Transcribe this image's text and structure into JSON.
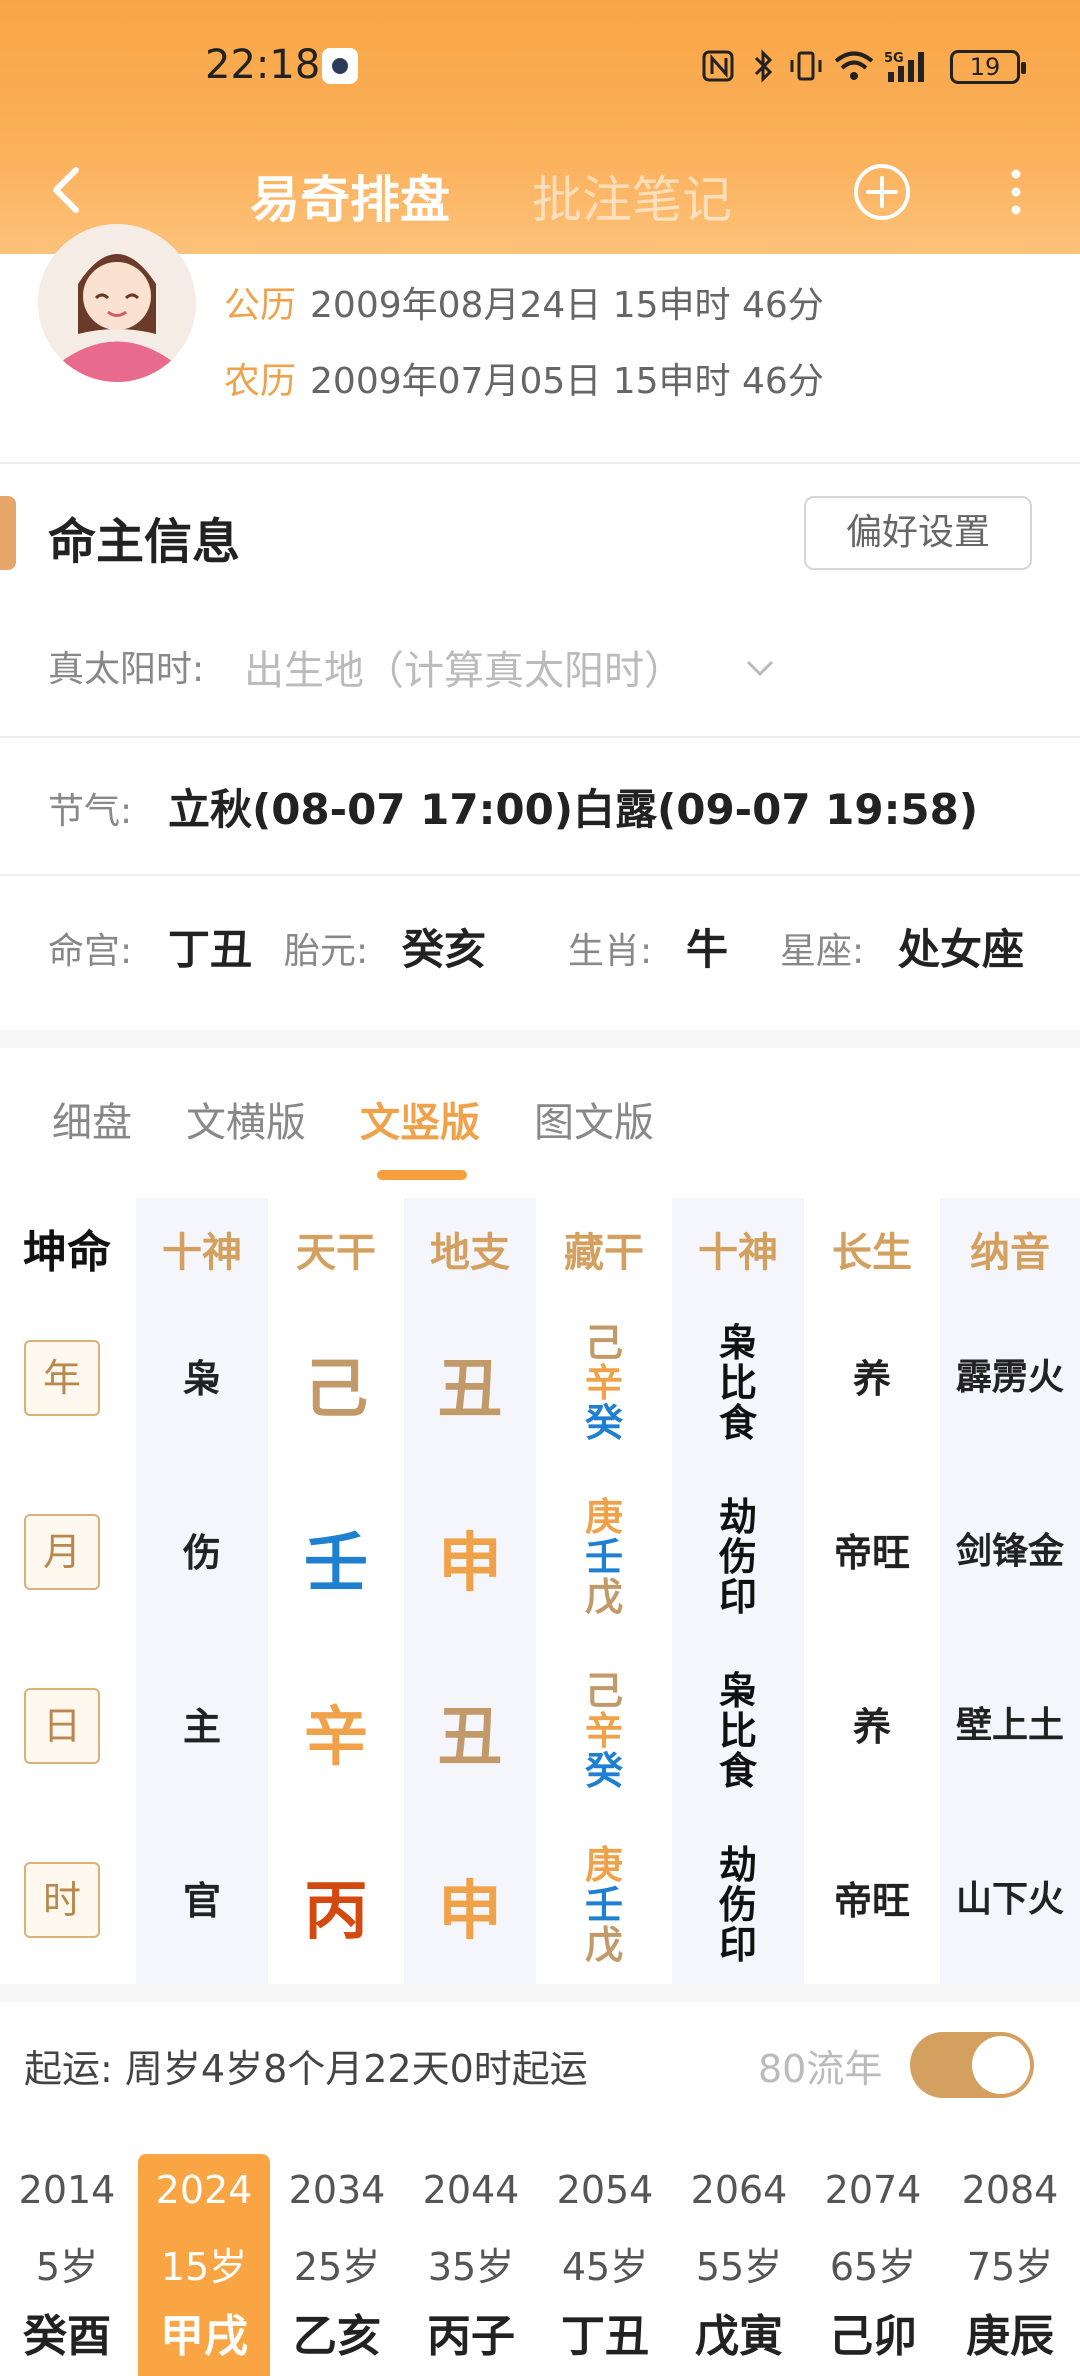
{
  "status": {
    "time": "22:18",
    "battery": "19"
  },
  "nav": {
    "tab_active": "易奇排盘",
    "tab_inactive": "批注笔记"
  },
  "profile": {
    "solar_label": "公历",
    "solar_value": "2009年08月24日 15申时 46分",
    "lunar_label": "农历",
    "lunar_value": "2009年07月05日 15申时 46分"
  },
  "info": {
    "title": "命主信息",
    "pref_button": "偏好设置",
    "solar_time_label": "真太阳时:",
    "solar_time_placeholder": "出生地（计算真太阳时）",
    "jieqi_label": "节气:",
    "jieqi_value": "立秋(08-07 17:00)白露(09-07 19:58)",
    "minggong_label": "命宫:",
    "minggong_value": "丁丑",
    "taiyuan_label": "胎元:",
    "taiyuan_value": "癸亥",
    "shengxiao_label": "生肖:",
    "shengxiao_value": "牛",
    "xingzuo_label": "星座:",
    "xingzuo_value": "处女座"
  },
  "views": [
    "细盘",
    "文横版",
    "文竖版",
    "图文版"
  ],
  "chart": {
    "corner": "坤命",
    "headers": [
      "十神",
      "天干",
      "地支",
      "藏干",
      "十神",
      "长生",
      "纳音"
    ],
    "rows": [
      {
        "pillar": "年",
        "shishen": "枭",
        "gan": "己",
        "zhi": "丑",
        "canggan": [
          "己",
          "辛",
          "癸"
        ],
        "ss2": [
          "枭",
          "比",
          "食"
        ],
        "cs": "养",
        "ny": "霹雳火"
      },
      {
        "pillar": "月",
        "shishen": "伤",
        "gan": "壬",
        "zhi": "申",
        "canggan": [
          "庚",
          "壬",
          "戊"
        ],
        "ss2": [
          "劫",
          "伤",
          "印"
        ],
        "cs": "帝旺",
        "ny": "剑锋金"
      },
      {
        "pillar": "日",
        "shishen": "主",
        "gan": "辛",
        "zhi": "丑",
        "canggan": [
          "己",
          "辛",
          "癸"
        ],
        "ss2": [
          "枭",
          "比",
          "食"
        ],
        "cs": "养",
        "ny": "壁上土"
      },
      {
        "pillar": "时",
        "shishen": "官",
        "gan": "丙",
        "zhi": "申",
        "canggan": [
          "庚",
          "壬",
          "戊"
        ],
        "ss2": [
          "劫",
          "伤",
          "印"
        ],
        "cs": "帝旺",
        "ny": "山下火"
      }
    ],
    "colors": {
      "earth": "#c29a6a",
      "water": "#1f7fd0",
      "metal": "#f0a24b",
      "fire": "#d44a0e",
      "header": "#d4a060"
    }
  },
  "fortune": {
    "start_label": "起运:",
    "start_value": "周岁4岁8个月22天0时起运",
    "liunian_label": "80流年",
    "decades": [
      {
        "year": "2014",
        "age": "5岁",
        "gz": "癸酉"
      },
      {
        "year": "2024",
        "age": "15岁",
        "gz": "甲戌"
      },
      {
        "year": "2034",
        "age": "25岁",
        "gz": "乙亥"
      },
      {
        "year": "2044",
        "age": "35岁",
        "gz": "丙子"
      },
      {
        "year": "2054",
        "age": "45岁",
        "gz": "丁丑"
      },
      {
        "year": "2064",
        "age": "55岁",
        "gz": "戊寅"
      },
      {
        "year": "2074",
        "age": "65岁",
        "gz": "己卯"
      },
      {
        "year": "2084",
        "age": "75岁",
        "gz": "庚辰"
      }
    ]
  }
}
